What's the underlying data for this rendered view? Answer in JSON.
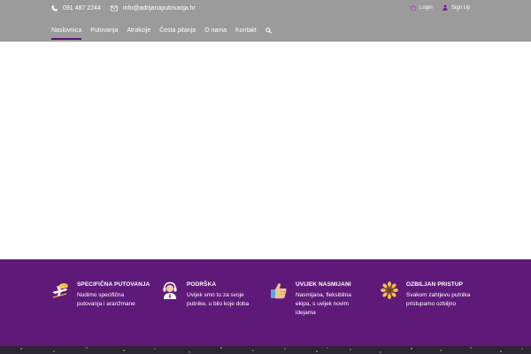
{
  "header": {
    "phone": "091 487 2244",
    "email": "info@adrijanaputovanja.hr",
    "login_label": "Login",
    "signup_label": "Sign Up"
  },
  "nav": {
    "items": [
      {
        "label": "Naslovnica",
        "active": true
      },
      {
        "label": "Putovanja"
      },
      {
        "label": "Atrakcije"
      },
      {
        "label": "Česta pitanja"
      },
      {
        "label": "O nama"
      },
      {
        "label": "Kontakt"
      }
    ],
    "search_icon": "search-icon"
  },
  "features": [
    {
      "icon": "plane-cloud-icon",
      "title": "SPECIFIČNA PUTOVANJA",
      "desc": "Nudimo specifična putovanja i aranžmane"
    },
    {
      "icon": "support-agent-icon",
      "title": "PODRŠKA",
      "desc": "Uvijek smo tu za svoje putnike, u bilo koje doba"
    },
    {
      "icon": "thumbs-up-icon",
      "title": "UVIJEK NASMIJANI",
      "desc": "Nasmijana, fleksibilna ekipa, s uvijek novim idejama"
    },
    {
      "icon": "sunflower-icon",
      "title": "OZBILJAN PRISTUP",
      "desc": "Svakom zahtjevu putnika pristupamo ozbiljno"
    }
  ],
  "colors": {
    "topbar": "#9b9b9b",
    "features_bg": "#5f1a79",
    "accent": "#5a1273",
    "night": "#2b2634"
  }
}
